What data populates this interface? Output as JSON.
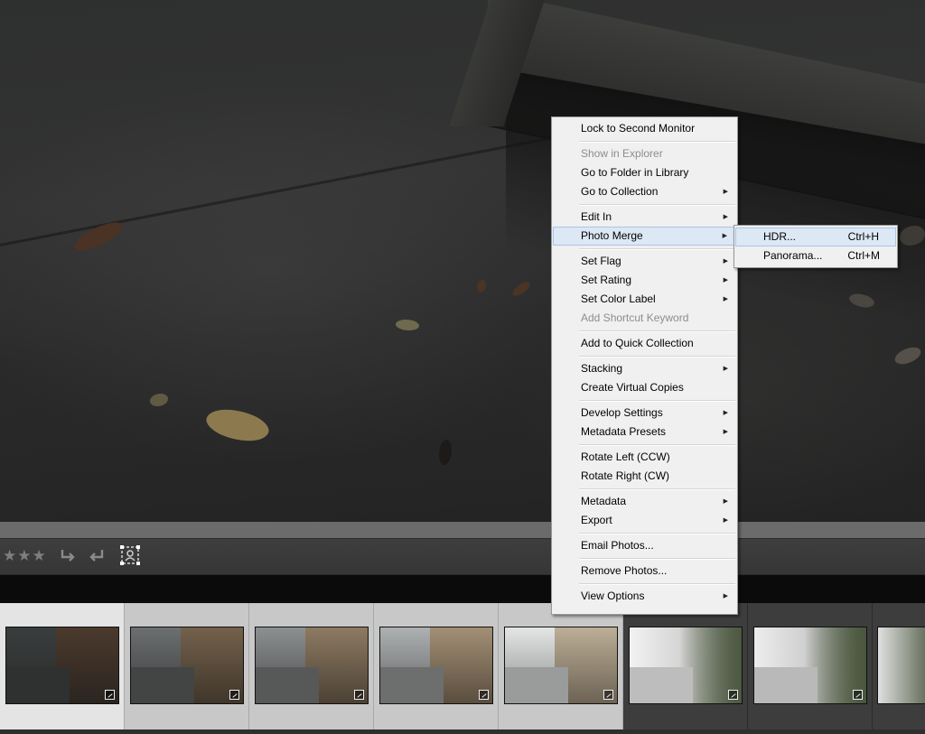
{
  "context_menu": {
    "items": [
      {
        "label": "Lock to Second Monitor",
        "disabled": false,
        "submenu": false
      },
      {
        "label": "Show in Explorer",
        "disabled": true,
        "submenu": false
      },
      {
        "label": "Go to Folder in Library",
        "disabled": false,
        "submenu": false
      },
      {
        "label": "Go to Collection",
        "disabled": false,
        "submenu": true
      },
      {
        "label": "Edit In",
        "disabled": false,
        "submenu": true
      },
      {
        "label": "Photo Merge",
        "disabled": false,
        "submenu": true,
        "highlighted": true
      },
      {
        "label": "Set Flag",
        "disabled": false,
        "submenu": true
      },
      {
        "label": "Set Rating",
        "disabled": false,
        "submenu": true
      },
      {
        "label": "Set Color Label",
        "disabled": false,
        "submenu": true
      },
      {
        "label": "Add Shortcut Keyword",
        "disabled": true,
        "submenu": false
      },
      {
        "label": "Add to Quick Collection",
        "disabled": false,
        "submenu": false
      },
      {
        "label": "Stacking",
        "disabled": false,
        "submenu": true
      },
      {
        "label": "Create Virtual Copies",
        "disabled": false,
        "submenu": false
      },
      {
        "label": "Develop Settings",
        "disabled": false,
        "submenu": true
      },
      {
        "label": "Metadata Presets",
        "disabled": false,
        "submenu": true
      },
      {
        "label": "Rotate Left (CCW)",
        "disabled": false,
        "submenu": false
      },
      {
        "label": "Rotate Right (CW)",
        "disabled": false,
        "submenu": false
      },
      {
        "label": "Metadata",
        "disabled": false,
        "submenu": true
      },
      {
        "label": "Export",
        "disabled": false,
        "submenu": true
      },
      {
        "label": "Email Photos...",
        "disabled": false,
        "submenu": false
      },
      {
        "label": "Remove Photos...",
        "disabled": false,
        "submenu": false
      },
      {
        "label": "View Options",
        "disabled": false,
        "submenu": true
      }
    ],
    "submenu_arrow": "▶"
  },
  "photo_merge_submenu": {
    "items": [
      {
        "label": "HDR...",
        "shortcut": "Ctrl+H",
        "highlighted": true
      },
      {
        "label": "Panorama...",
        "shortcut": "Ctrl+M",
        "highlighted": false
      }
    ]
  },
  "toolbar": {
    "rating_stars": "★★★",
    "icons": [
      "rotate-left-icon",
      "rotate-right-icon",
      "crop-overlay-icon"
    ]
  },
  "filmstrip": {
    "thumbnails": [
      {
        "scene": "bench-path",
        "tone": "dark",
        "selected": true
      },
      {
        "scene": "bench-path",
        "tone": "mid",
        "selected": false
      },
      {
        "scene": "bench-path",
        "tone": "mid-light",
        "selected": false
      },
      {
        "scene": "bench-path",
        "tone": "light",
        "selected": false
      },
      {
        "scene": "bench-path",
        "tone": "very-light",
        "selected": false
      },
      {
        "scene": "foggy-forest",
        "tone": "foggy",
        "selected": false
      },
      {
        "scene": "foggy-forest",
        "tone": "foggy",
        "selected": false
      },
      {
        "scene": "foggy-forest",
        "tone": "foggy",
        "selected": false
      }
    ]
  },
  "colors": {
    "menu_bg": "#f0f0f0",
    "menu_highlight": "#dde8f5",
    "menu_highlight_border": "#a8c6e6",
    "disabled_text": "#8d8d8d",
    "filmstrip_selected": "#e4e4e4",
    "filmstrip_light": "#c8c8c8",
    "filmstrip_dark": "#3d3d3d"
  }
}
